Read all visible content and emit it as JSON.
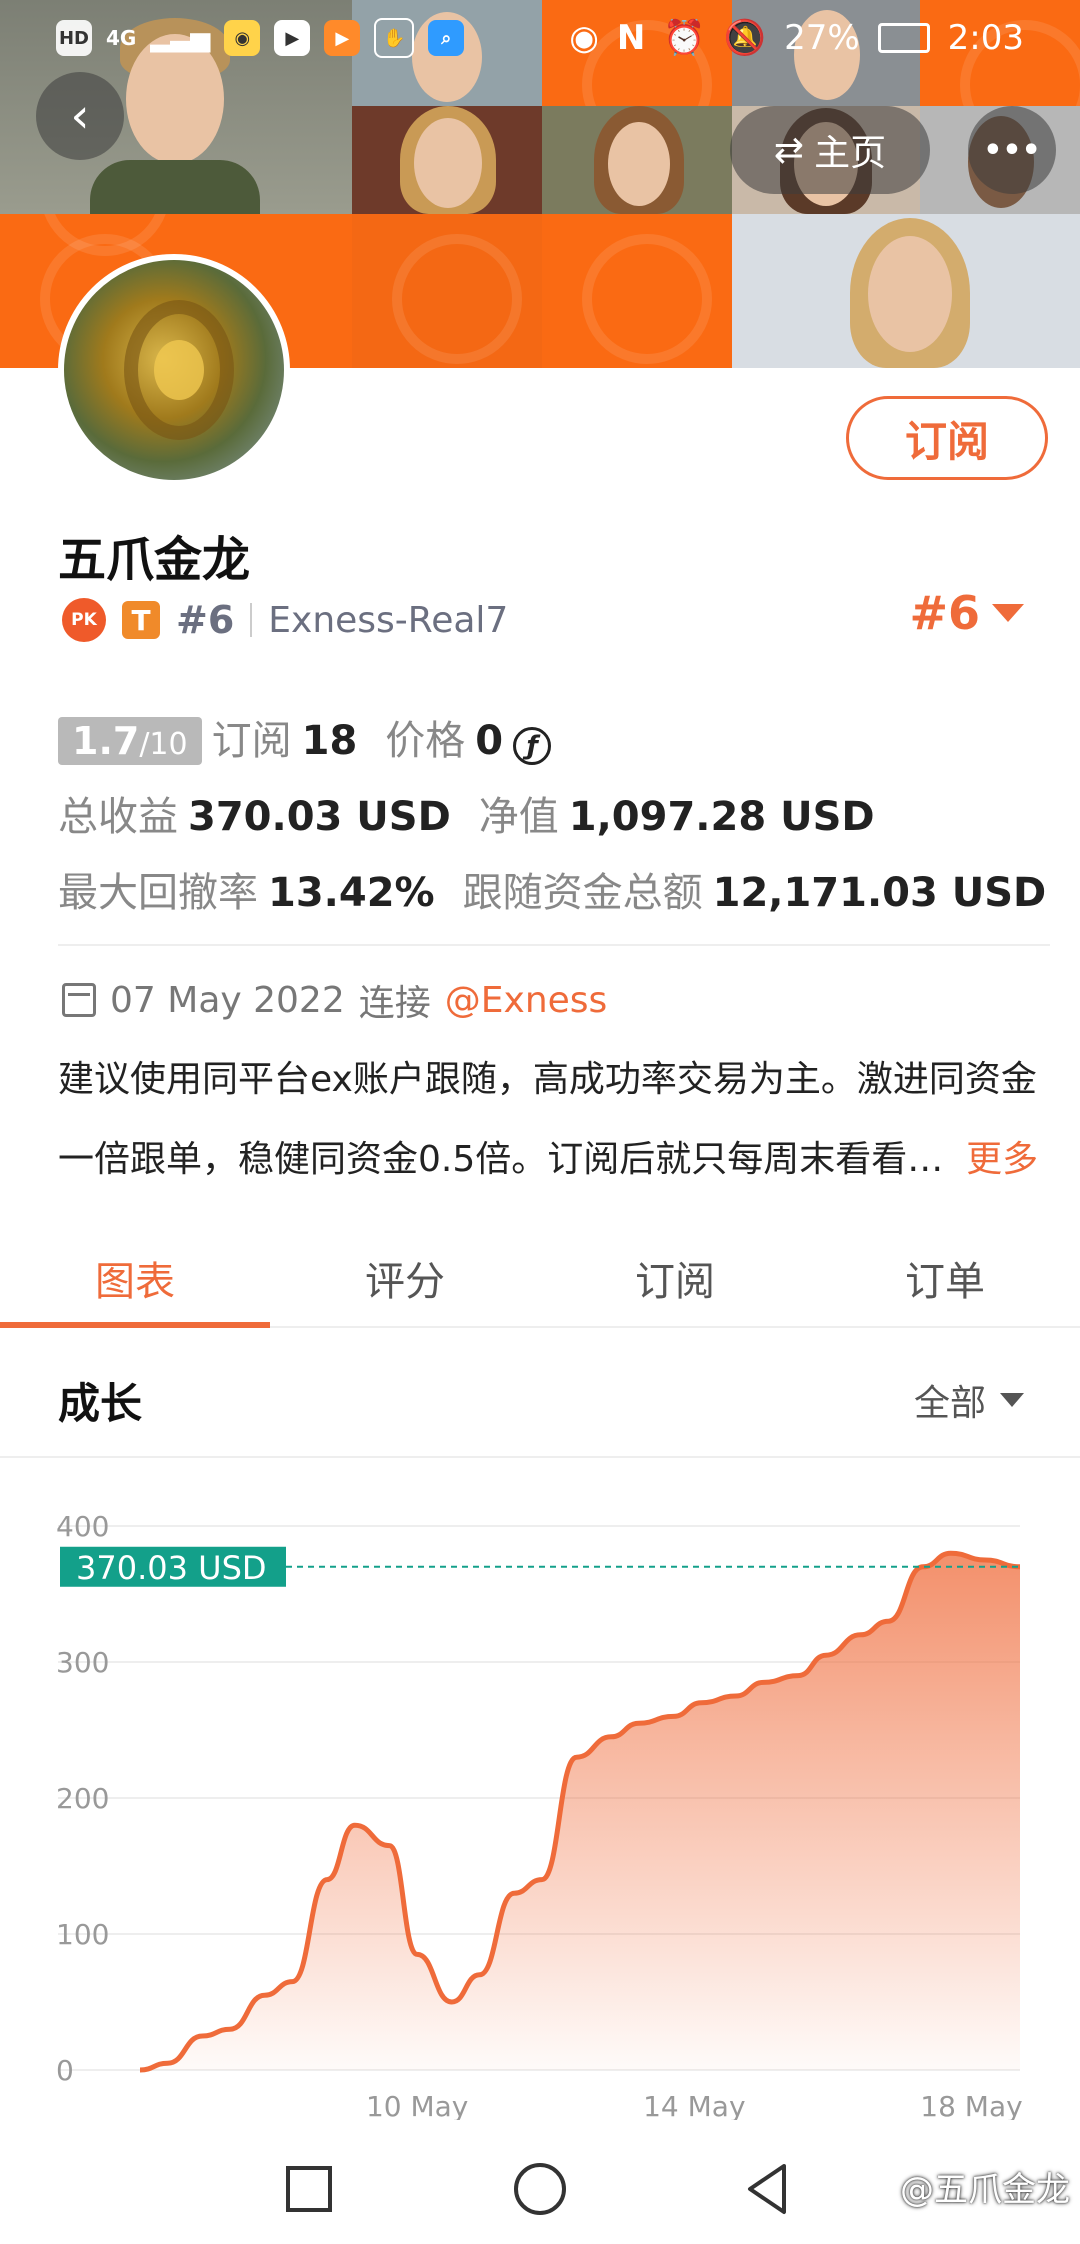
{
  "status_bar": {
    "left_label": "HD",
    "signal": "4G",
    "battery": "27%",
    "time": "2:03"
  },
  "header": {
    "home_label": "主页",
    "more_label": "•••"
  },
  "profile": {
    "subscribe_label": "订阅",
    "name": "五爪金龙",
    "pk_badge": "PK",
    "t_badge": "T",
    "rank": "#6",
    "broker_account": "Exness-Real7",
    "rank_right": "#6"
  },
  "stats": {
    "score_main": "1.7",
    "score_den": "/10",
    "subscribe_label": "订阅",
    "subscribe_count": "18",
    "price_label": "价格",
    "price_value": "0",
    "price_icon": "ƒ",
    "total_profit_label": "总收益",
    "total_profit_value": "370.03 USD",
    "equity_label": "净值",
    "equity_value": "1,097.28 USD",
    "max_drawdown_label": "最大回撤率",
    "max_drawdown_value": "13.42%",
    "follow_funds_label": "跟随资金总额",
    "follow_funds_value": "12,171.03 USD"
  },
  "connection": {
    "date": "07 May 2022",
    "connect_label": "连接",
    "broker": "@Exness"
  },
  "description": {
    "line1": "建议使用同平台ex账户跟随，高成功率交易为主。激进同资金",
    "line2": "一倍跟单，稳健同资金0.5倍。订阅后就只每周末看看…",
    "more": "更多"
  },
  "tabs": [
    {
      "label": "图表",
      "active": true
    },
    {
      "label": "评分",
      "active": false
    },
    {
      "label": "订阅",
      "active": false
    },
    {
      "label": "订单",
      "active": false
    }
  ],
  "growth": {
    "title": "成长",
    "filter": "全部"
  },
  "chart_data": {
    "type": "area",
    "current_label": "370.03 USD",
    "current_value": 370.03,
    "ylim": [
      0,
      400
    ],
    "yticks": [
      0,
      100,
      200,
      300,
      400
    ],
    "xtick_labels": [
      "10 May",
      "14 May",
      "18 May"
    ],
    "xtick_positions": [
      4,
      8,
      12
    ],
    "series": [
      {
        "x": [
          0,
          0.4,
          0.9,
          1.3,
          1.8,
          2.2,
          2.7,
          3.1,
          3.6,
          4.0,
          4.5,
          4.9,
          5.4,
          5.8,
          6.3,
          6.8,
          7.2,
          7.7,
          8.1,
          8.6,
          9.0,
          9.5,
          9.9,
          10.4,
          10.8,
          11.3,
          11.7,
          12.2,
          12.7
        ],
        "y": [
          0,
          5,
          25,
          30,
          55,
          65,
          140,
          180,
          165,
          85,
          50,
          70,
          130,
          140,
          230,
          245,
          255,
          260,
          270,
          275,
          285,
          290,
          305,
          320,
          330,
          370,
          380,
          375,
          370
        ]
      }
    ],
    "line_color": "#ef6b3a",
    "label_color": "#13a08a"
  },
  "watermark": "@五爪金龙"
}
